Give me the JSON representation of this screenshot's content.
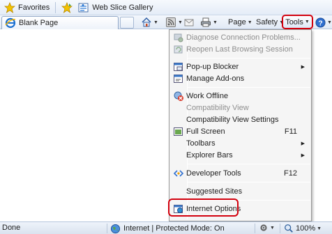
{
  "favorites_bar": {
    "favorites_label": "Favorites",
    "web_slice_label": "Web Slice Gallery"
  },
  "tab": {
    "title": "Blank Page"
  },
  "command_bar": {
    "page_label": "Page",
    "safety_label": "Safety",
    "tools_label": "Tools"
  },
  "tools_menu": {
    "items": [
      {
        "label": "Diagnose Connection Problems...",
        "disabled": true,
        "icon": "diagnose-icon"
      },
      {
        "label": "Reopen Last Browsing Session",
        "disabled": true,
        "icon": "reopen-session-icon"
      },
      {
        "label": "Pop-up Blocker",
        "submenu": true,
        "icon": "popup-blocker-icon"
      },
      {
        "label": "Manage Add-ons",
        "icon": "addons-icon"
      },
      {
        "label": "Work Offline",
        "icon": "work-offline-icon"
      },
      {
        "label": "Compatibility View",
        "disabled": true
      },
      {
        "label": "Compatibility View Settings"
      },
      {
        "label": "Full Screen",
        "shortcut": "F11",
        "icon": "full-screen-icon"
      },
      {
        "label": "Toolbars",
        "submenu": true
      },
      {
        "label": "Explorer Bars",
        "submenu": true
      },
      {
        "label": "Developer Tools",
        "shortcut": "F12",
        "icon": "developer-tools-icon"
      },
      {
        "label": "Suggested Sites"
      },
      {
        "label": "Internet Options",
        "icon": "internet-options-icon"
      }
    ]
  },
  "status_bar": {
    "status_text": "Done",
    "zone_text": "Internet | Protected Mode: On",
    "zoom_text": "100%"
  },
  "colors": {
    "highlight_red": "#d2000d",
    "disabled_text": "#8e8e8e"
  }
}
